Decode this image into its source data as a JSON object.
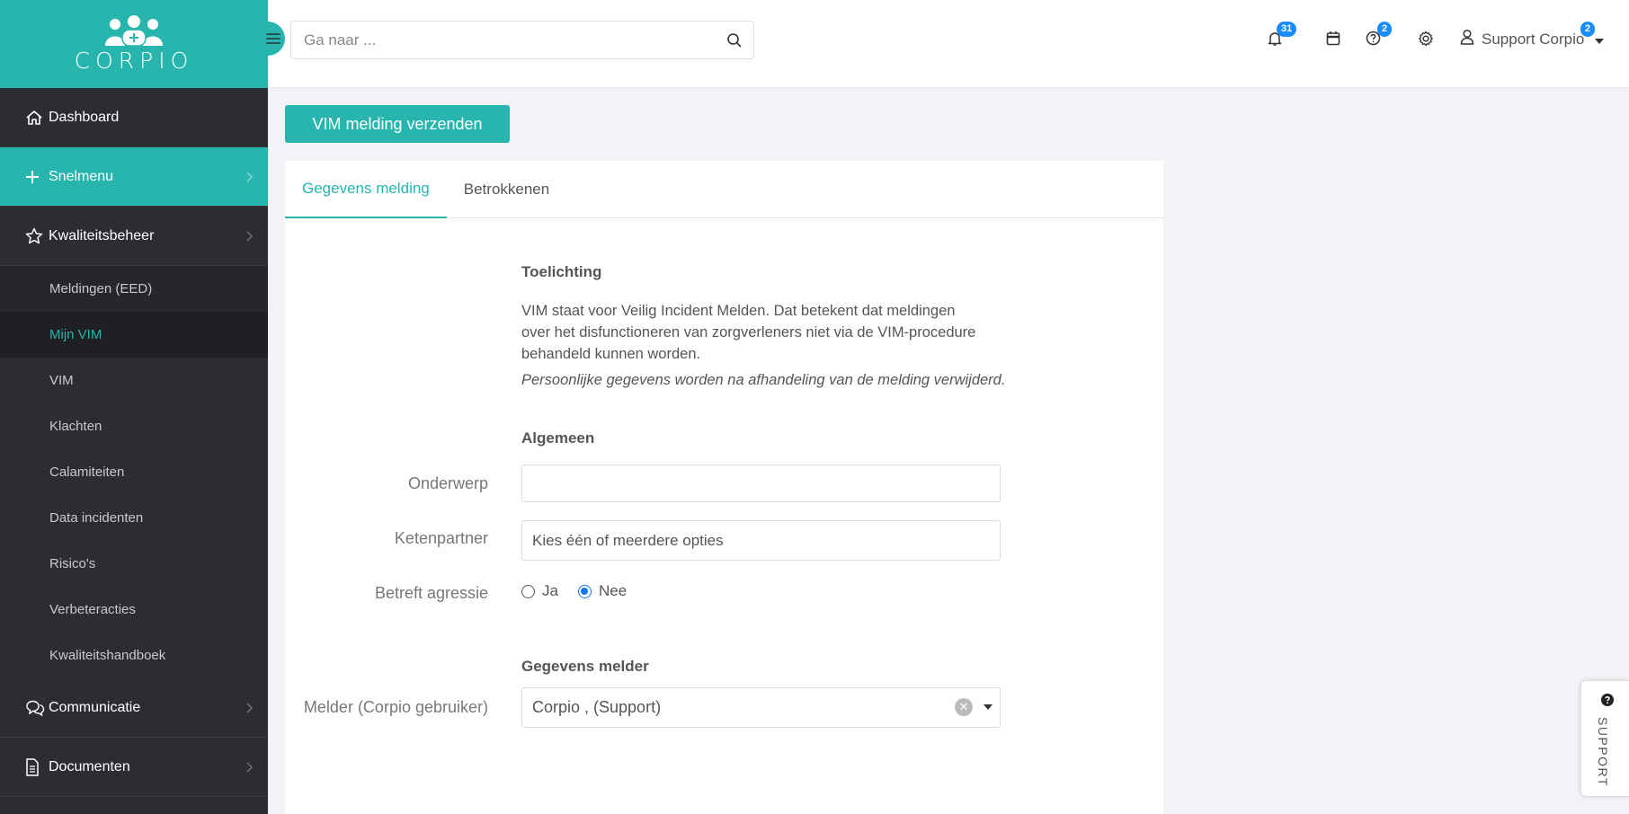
{
  "brand": {
    "logo_text": "CORPIO",
    "accent": "#27b5ae",
    "sidebar_bg": "#2c2d33"
  },
  "sidebar": {
    "items": [
      {
        "label": "Dashboard",
        "icon": "home-icon"
      },
      {
        "label": "Snelmenu",
        "icon": "plus-icon"
      },
      {
        "label": "Kwaliteitsbeheer",
        "icon": "star-icon"
      },
      {
        "label": "Communicatie",
        "icon": "chat-icon"
      },
      {
        "label": "Documenten",
        "icon": "document-icon"
      }
    ],
    "sub_items": [
      "Meldingen (EED)",
      "Mijn VIM",
      "VIM",
      "Klachten",
      "Calamiteiten",
      "Data incidenten",
      "Risico's",
      "Verbeteracties",
      "Kwaliteitshandboek"
    ]
  },
  "header": {
    "search_placeholder": "Ga naar ...",
    "notifications_count": "31",
    "help_count": "2",
    "user_badge": "2",
    "user_name": "Support Corpio"
  },
  "main": {
    "send_button": "VIM melding verzenden",
    "tabs": [
      "Gegevens melding",
      "Betrokkenen"
    ],
    "toelichting_title": "Toelichting",
    "toelichting_text": "VIM staat voor Veilig Incident Melden. Dat betekent dat meldingen over het disfunctioneren van zorgverleners niet via de VIM-procedure behandeld kunnen worden.",
    "privacy_note": "Persoonlijke gegevens worden na afhandeling van de melding verwijderd.",
    "algemeen_title": "Algemeen",
    "onderwerp_label": "Onderwerp",
    "onderwerp_value": "",
    "ketenpartner_label": "Ketenpartner",
    "ketenpartner_placeholder": "Kies één of meerdere opties",
    "agressie_label": "Betreft agressie",
    "agressie_options": [
      "Ja",
      "Nee"
    ],
    "agressie_selected": "Nee",
    "melder_title": "Gegevens melder",
    "melder_label": "Melder (Corpio gebruiker)",
    "melder_value": "Corpio , (Support)"
  },
  "support_tab": {
    "label": "SUPPORT"
  }
}
